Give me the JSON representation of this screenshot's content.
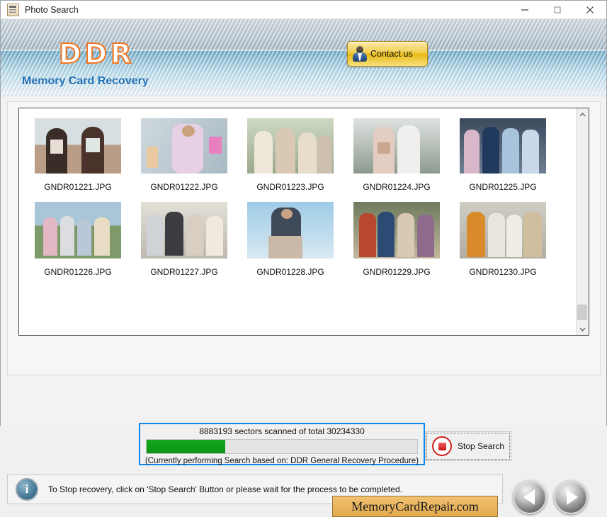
{
  "window": {
    "title": "Photo Search",
    "icon": "photo-search-icon",
    "controls": {
      "minimize": "—",
      "maximize": "□",
      "close": "✕"
    }
  },
  "header": {
    "logo": "DDR",
    "subtitle": "Memory Card Recovery",
    "contact_label": "Contact us",
    "contact_icon": "user-avatar-icon",
    "logo_color": "#f2741f",
    "subtitle_color": "#1f6fb5"
  },
  "gallery": {
    "scrollbar": {
      "up": "⌃",
      "down": "⌄"
    },
    "items": [
      {
        "name": "GNDR01221.JPG"
      },
      {
        "name": "GNDR01222.JPG"
      },
      {
        "name": "GNDR01223.JPG"
      },
      {
        "name": "GNDR01224.JPG"
      },
      {
        "name": "GNDR01225.JPG"
      },
      {
        "name": "GNDR01226.JPG"
      },
      {
        "name": "GNDR01227.JPG"
      },
      {
        "name": "GNDR01228.JPG"
      },
      {
        "name": "GNDR01229.JPG"
      },
      {
        "name": "GNDR01230.JPG"
      }
    ]
  },
  "progress": {
    "title": "8883193 sectors scanned of total 30234330",
    "sectors_scanned": 8883193,
    "sectors_total": 30234330,
    "percent": 29,
    "note": "(Currently performing Search based on:  DDR General Recovery Procedure)",
    "bar_color": "#0f9415",
    "border_color": "#0f86e8"
  },
  "stop_button": {
    "label": "Stop Search",
    "icon": "stop-square-icon"
  },
  "status": {
    "icon": "info-icon",
    "text": "To Stop recovery, click on 'Stop Search' Button or please wait for the process to be completed."
  },
  "watermark": {
    "text": "MemoryCardRepair.com"
  },
  "navigation": {
    "prev_icon": "arrow-left-icon",
    "next_icon": "arrow-right-icon"
  }
}
